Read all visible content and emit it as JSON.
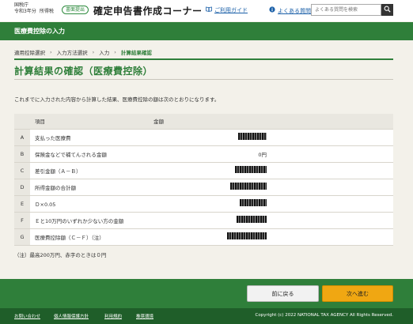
{
  "header": {
    "agency": "国税庁",
    "year": "令和3年分",
    "tax_type": "所得税",
    "badge": "書面提出",
    "app_title": "確定申告書作成コーナー",
    "guide_link": "ご利用ガイド",
    "faq_link": "よくある質問",
    "search_placeholder": "よくある質問を検索"
  },
  "section": {
    "title": "医療費控除の入力"
  },
  "steps": [
    {
      "label": "適用控除選択",
      "active": false
    },
    {
      "label": "入力方法選択",
      "active": false
    },
    {
      "label": "入力",
      "active": false
    },
    {
      "label": "計算結果確認",
      "active": true
    }
  ],
  "page": {
    "title": "計算結果の確認（医療費控除）",
    "intro": "これまでに入力された内容から計算した結果、医療費控除の額は次のとおりになります。",
    "note": "（注）最高200万円、赤字のときは０円"
  },
  "table": {
    "headers": {
      "letter": "",
      "item": "項目",
      "amount": "金額"
    },
    "rows": [
      {
        "letter": "A",
        "item": "支払った医療費",
        "amount": ""
      },
      {
        "letter": "B",
        "item": "保険金などで補てんされる金額",
        "amount": "0円"
      },
      {
        "letter": "C",
        "item": "差引金額（Ａ－Ｂ）",
        "amount": ""
      },
      {
        "letter": "D",
        "item": "所得金額の合計額",
        "amount": ""
      },
      {
        "letter": "E",
        "item": "Ｄ×0.05",
        "amount": ""
      },
      {
        "letter": "F",
        "item": "Ｅと10万円のいずれか少ない方の金額",
        "amount": ""
      },
      {
        "letter": "G",
        "item": "医療費控除額（Ｃ－Ｆ）（注）",
        "amount": ""
      }
    ]
  },
  "actions": {
    "back": "前に戻る",
    "next": "次へ進む"
  },
  "footer": {
    "links": [
      "お問い合わせ",
      "個人情報保護方針",
      "利用規約",
      "推奨環境"
    ],
    "copyright": "Copyright (c) 2022 NATIONAL TAX AGENCY All Rights Reserved."
  },
  "colors": {
    "brand_green": "#2f7f3a",
    "next_button": "#f0a712"
  },
  "icons": {
    "guide": "book-icon",
    "faq": "info-circle-icon",
    "search": "search-icon"
  }
}
